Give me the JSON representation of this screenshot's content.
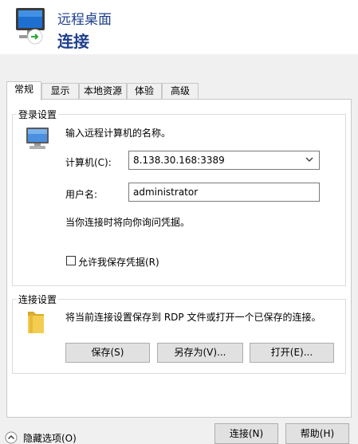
{
  "window": {
    "title_line1": "远程桌面",
    "title_line2": "连接"
  },
  "tabs": [
    {
      "label": "常规"
    },
    {
      "label": "显示"
    },
    {
      "label": "本地资源"
    },
    {
      "label": "体验"
    },
    {
      "label": "高级"
    }
  ],
  "login_settings": {
    "group_title": "登录设置",
    "instruction": "输入远程计算机的名称。",
    "computer_label": "计算机(C):",
    "computer_value": "8.138.30.168:3389",
    "username_label": "用户名:",
    "username_value": "administrator",
    "note": "当你连接时将向你询问凭据。",
    "save_credentials_label": "允许我保存凭据(R)"
  },
  "connection_settings": {
    "group_title": "连接设置",
    "description": "将当前连接设置保存到 RDP 文件或打开一个已保存的连接。",
    "save_label": "保存(S)",
    "save_as_label": "另存为(V)...",
    "open_label": "打开(E)..."
  },
  "footer": {
    "hide_options_label": "隐藏选项(O)",
    "connect_label": "连接(N)",
    "help_label": "帮助(H)"
  }
}
